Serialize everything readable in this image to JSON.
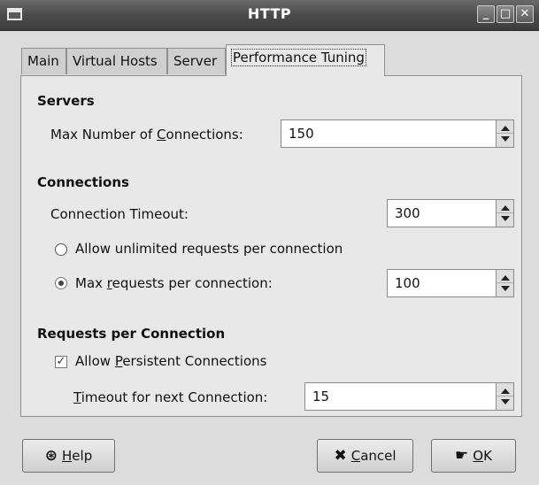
{
  "window": {
    "title": "HTTP",
    "controls": {
      "minimize": "_",
      "maximize": "□",
      "close": "✕"
    }
  },
  "tabs": [
    {
      "label": "Main",
      "active": false
    },
    {
      "label": "Virtual Hosts",
      "active": false
    },
    {
      "label": "Server",
      "active": false
    },
    {
      "label": "Performance Tuning",
      "active": true
    }
  ],
  "servers": {
    "heading": "Servers",
    "max_connections_label_pre": "Max Number of ",
    "max_connections_label_ul": "C",
    "max_connections_label_post": "onnections:",
    "max_connections_value": "150"
  },
  "connections": {
    "heading": "Connections",
    "timeout_label": "Connection Timeout:",
    "timeout_value": "300",
    "unlimited_label": "Allow unlimited requests per connection",
    "unlimited_selected": false,
    "max_requests_label_pre": "Max ",
    "max_requests_label_ul": "r",
    "max_requests_label_post": "equests per connection:",
    "max_requests_selected": true,
    "max_requests_value": "100"
  },
  "requests_per_connection": {
    "heading": "Requests per Connection",
    "persistent_label_pre": "Allow ",
    "persistent_label_ul": "P",
    "persistent_label_post": "ersistent Connections",
    "persistent_checked": true,
    "next_timeout_label_ul": "T",
    "next_timeout_label_post": "imeout for next Connection:",
    "next_timeout_value": "15"
  },
  "buttons": {
    "help_ul": "H",
    "help_post": "elp",
    "cancel_ul": "C",
    "cancel_post": "ancel",
    "ok_ul": "O",
    "ok_post": "K"
  },
  "icons": {
    "help": "life-ring-icon",
    "cancel": "x-mark-icon",
    "ok": "hand-pointer-icon"
  }
}
